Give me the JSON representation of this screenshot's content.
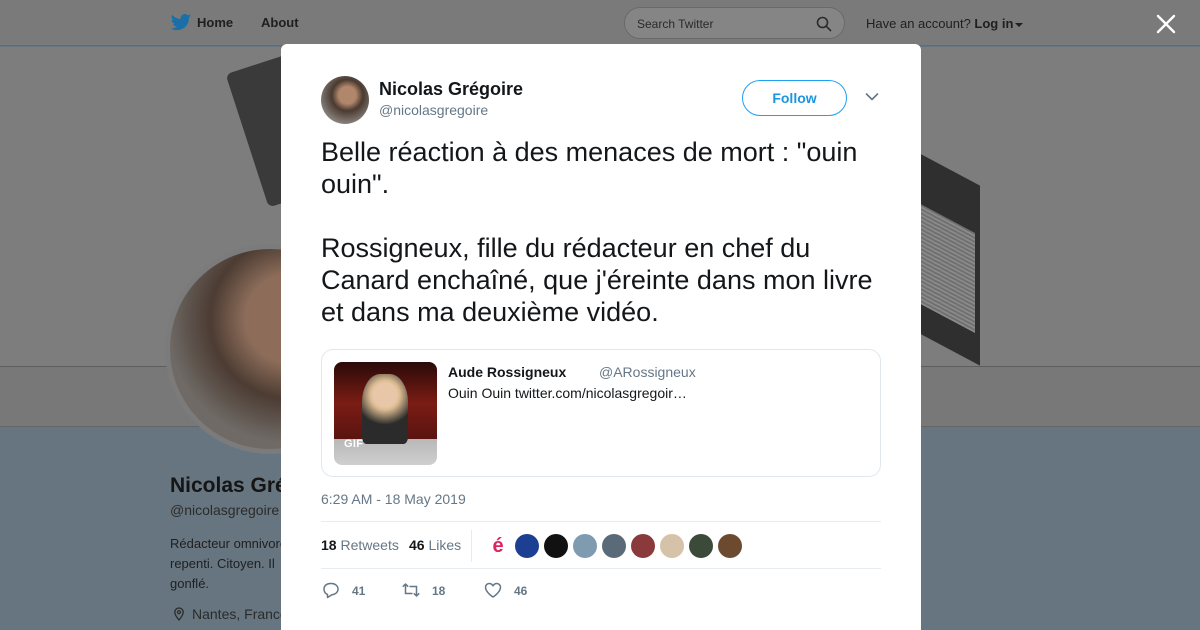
{
  "header": {
    "home_label": "Home",
    "about_label": "About",
    "search_placeholder": "Search Twitter",
    "account_prompt": "Have an account?",
    "login_label": "Log in"
  },
  "profile": {
    "name": "Nicolas Grégoire",
    "handle": "@nicolasgregoire",
    "bio_lines": [
      "Rédacteur omnivore,",
      "repenti. Citoyen. Il",
      "gonflé."
    ],
    "location": "Nantes, France"
  },
  "tweet": {
    "author_name": "Nicolas Grégoire",
    "author_handle": "@nicolasgregoire",
    "follow_label": "Follow",
    "text_paragraphs": [
      "Belle réaction à des menaces de mort : \"ouin ouin\".",
      "Rossigneux, fille du rédacteur en chef du Canard enchaîné, que j'éreinte dans mon livre et dans ma deuxième vidéo."
    ],
    "quote": {
      "name": "Aude Rossigneux",
      "handle": "@ARossigneux",
      "text": "Ouin Ouin twitter.com/nicolasgregoir…",
      "media_badge": "GIF"
    },
    "timestamp": "6:29 AM - 18 May 2019",
    "retweets": {
      "count": "18",
      "label": "Retweets"
    },
    "likes": {
      "count": "46",
      "label": "Likes"
    },
    "likers": [
      {
        "name": "liker-1",
        "color": "#ffffff",
        "glyph": "é",
        "glyph_color": "#e0245e"
      },
      {
        "name": "liker-2",
        "color": "#1c3f94",
        "glyph": "",
        "glyph_color": ""
      },
      {
        "name": "liker-3",
        "color": "#111111",
        "glyph": "",
        "glyph_color": ""
      },
      {
        "name": "liker-4",
        "color": "#7f9bb0",
        "glyph": "",
        "glyph_color": ""
      },
      {
        "name": "liker-5",
        "color": "#5b6a78",
        "glyph": "",
        "glyph_color": ""
      },
      {
        "name": "liker-6",
        "color": "#8a3a3a",
        "glyph": "",
        "glyph_color": ""
      },
      {
        "name": "liker-7",
        "color": "#d6c2a8",
        "glyph": "",
        "glyph_color": ""
      },
      {
        "name": "liker-8",
        "color": "#3c4a3a",
        "glyph": "",
        "glyph_color": ""
      },
      {
        "name": "liker-9",
        "color": "#6b4a30",
        "glyph": "",
        "glyph_color": ""
      }
    ],
    "actions": {
      "replies": "41",
      "retweets": "18",
      "likes": "46"
    }
  },
  "colors": {
    "accent": "#1da1f2",
    "muted": "#657786",
    "text": "#14171a"
  }
}
